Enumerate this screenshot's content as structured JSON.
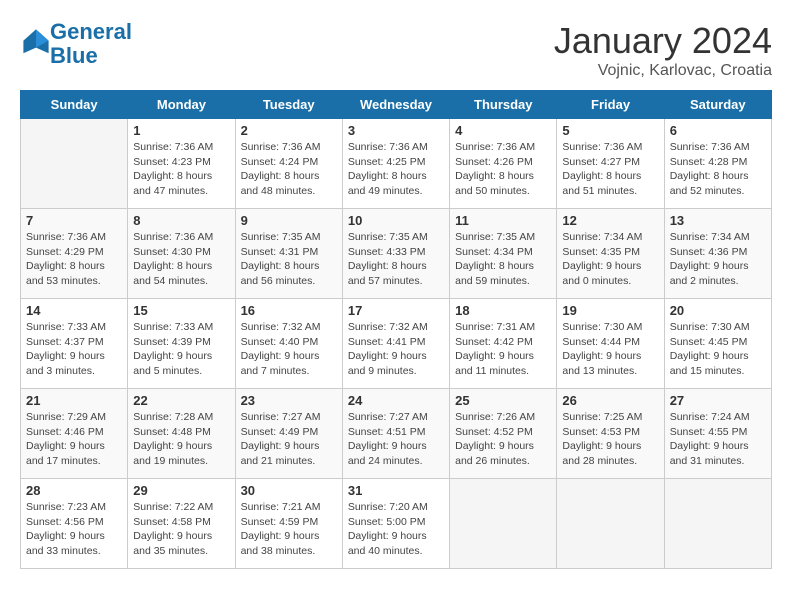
{
  "header": {
    "logo_line1": "General",
    "logo_line2": "Blue",
    "month_title": "January 2024",
    "location": "Vojnic, Karlovac, Croatia"
  },
  "days_of_week": [
    "Sunday",
    "Monday",
    "Tuesday",
    "Wednesday",
    "Thursday",
    "Friday",
    "Saturday"
  ],
  "weeks": [
    [
      {
        "day": "",
        "empty": true
      },
      {
        "day": "1",
        "sunrise": "7:36 AM",
        "sunset": "4:23 PM",
        "daylight": "8 hours and 47 minutes."
      },
      {
        "day": "2",
        "sunrise": "7:36 AM",
        "sunset": "4:24 PM",
        "daylight": "8 hours and 48 minutes."
      },
      {
        "day": "3",
        "sunrise": "7:36 AM",
        "sunset": "4:25 PM",
        "daylight": "8 hours and 49 minutes."
      },
      {
        "day": "4",
        "sunrise": "7:36 AM",
        "sunset": "4:26 PM",
        "daylight": "8 hours and 50 minutes."
      },
      {
        "day": "5",
        "sunrise": "7:36 AM",
        "sunset": "4:27 PM",
        "daylight": "8 hours and 51 minutes."
      },
      {
        "day": "6",
        "sunrise": "7:36 AM",
        "sunset": "4:28 PM",
        "daylight": "8 hours and 52 minutes."
      }
    ],
    [
      {
        "day": "7",
        "sunrise": "7:36 AM",
        "sunset": "4:29 PM",
        "daylight": "8 hours and 53 minutes."
      },
      {
        "day": "8",
        "sunrise": "7:36 AM",
        "sunset": "4:30 PM",
        "daylight": "8 hours and 54 minutes."
      },
      {
        "day": "9",
        "sunrise": "7:35 AM",
        "sunset": "4:31 PM",
        "daylight": "8 hours and 56 minutes."
      },
      {
        "day": "10",
        "sunrise": "7:35 AM",
        "sunset": "4:33 PM",
        "daylight": "8 hours and 57 minutes."
      },
      {
        "day": "11",
        "sunrise": "7:35 AM",
        "sunset": "4:34 PM",
        "daylight": "8 hours and 59 minutes."
      },
      {
        "day": "12",
        "sunrise": "7:34 AM",
        "sunset": "4:35 PM",
        "daylight": "9 hours and 0 minutes."
      },
      {
        "day": "13",
        "sunrise": "7:34 AM",
        "sunset": "4:36 PM",
        "daylight": "9 hours and 2 minutes."
      }
    ],
    [
      {
        "day": "14",
        "sunrise": "7:33 AM",
        "sunset": "4:37 PM",
        "daylight": "9 hours and 3 minutes."
      },
      {
        "day": "15",
        "sunrise": "7:33 AM",
        "sunset": "4:39 PM",
        "daylight": "9 hours and 5 minutes."
      },
      {
        "day": "16",
        "sunrise": "7:32 AM",
        "sunset": "4:40 PM",
        "daylight": "9 hours and 7 minutes."
      },
      {
        "day": "17",
        "sunrise": "7:32 AM",
        "sunset": "4:41 PM",
        "daylight": "9 hours and 9 minutes."
      },
      {
        "day": "18",
        "sunrise": "7:31 AM",
        "sunset": "4:42 PM",
        "daylight": "9 hours and 11 minutes."
      },
      {
        "day": "19",
        "sunrise": "7:30 AM",
        "sunset": "4:44 PM",
        "daylight": "9 hours and 13 minutes."
      },
      {
        "day": "20",
        "sunrise": "7:30 AM",
        "sunset": "4:45 PM",
        "daylight": "9 hours and 15 minutes."
      }
    ],
    [
      {
        "day": "21",
        "sunrise": "7:29 AM",
        "sunset": "4:46 PM",
        "daylight": "9 hours and 17 minutes."
      },
      {
        "day": "22",
        "sunrise": "7:28 AM",
        "sunset": "4:48 PM",
        "daylight": "9 hours and 19 minutes."
      },
      {
        "day": "23",
        "sunrise": "7:27 AM",
        "sunset": "4:49 PM",
        "daylight": "9 hours and 21 minutes."
      },
      {
        "day": "24",
        "sunrise": "7:27 AM",
        "sunset": "4:51 PM",
        "daylight": "9 hours and 24 minutes."
      },
      {
        "day": "25",
        "sunrise": "7:26 AM",
        "sunset": "4:52 PM",
        "daylight": "9 hours and 26 minutes."
      },
      {
        "day": "26",
        "sunrise": "7:25 AM",
        "sunset": "4:53 PM",
        "daylight": "9 hours and 28 minutes."
      },
      {
        "day": "27",
        "sunrise": "7:24 AM",
        "sunset": "4:55 PM",
        "daylight": "9 hours and 31 minutes."
      }
    ],
    [
      {
        "day": "28",
        "sunrise": "7:23 AM",
        "sunset": "4:56 PM",
        "daylight": "9 hours and 33 minutes."
      },
      {
        "day": "29",
        "sunrise": "7:22 AM",
        "sunset": "4:58 PM",
        "daylight": "9 hours and 35 minutes."
      },
      {
        "day": "30",
        "sunrise": "7:21 AM",
        "sunset": "4:59 PM",
        "daylight": "9 hours and 38 minutes."
      },
      {
        "day": "31",
        "sunrise": "7:20 AM",
        "sunset": "5:00 PM",
        "daylight": "9 hours and 40 minutes."
      },
      {
        "day": "",
        "empty": true
      },
      {
        "day": "",
        "empty": true
      },
      {
        "day": "",
        "empty": true
      }
    ]
  ]
}
